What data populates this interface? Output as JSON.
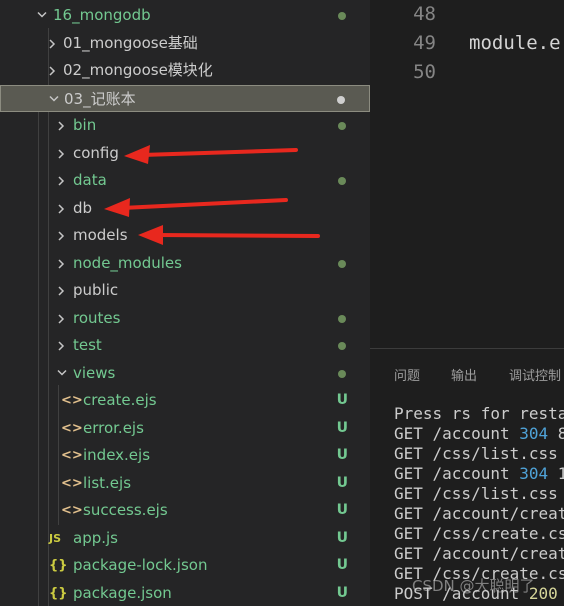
{
  "tree": [
    {
      "label": "16_mongodb",
      "kind": "folder-open",
      "indent": 0,
      "marker": "dot",
      "color": "#73c991"
    },
    {
      "label": "01_mongoose基础",
      "kind": "folder",
      "indent": 1,
      "color": "#cccccc"
    },
    {
      "label": "02_mongoose模块化",
      "kind": "folder",
      "indent": 1,
      "color": "#cccccc"
    },
    {
      "label": "03_记账本",
      "kind": "folder-open",
      "indent": 1,
      "selected": true,
      "marker": "dot-light",
      "color": "#cccccc"
    },
    {
      "label": "bin",
      "kind": "folder",
      "indent": 2,
      "marker": "dot",
      "color": "#73c991"
    },
    {
      "label": "config",
      "kind": "folder",
      "indent": 2,
      "color": "#cccccc"
    },
    {
      "label": "data",
      "kind": "folder",
      "indent": 2,
      "marker": "dot",
      "color": "#73c991"
    },
    {
      "label": "db",
      "kind": "folder",
      "indent": 2,
      "color": "#cccccc"
    },
    {
      "label": "models",
      "kind": "folder",
      "indent": 2,
      "color": "#cccccc"
    },
    {
      "label": "node_modules",
      "kind": "folder",
      "indent": 2,
      "marker": "dot",
      "color": "#73c991"
    },
    {
      "label": "public",
      "kind": "folder",
      "indent": 2,
      "color": "#cccccc"
    },
    {
      "label": "routes",
      "kind": "folder",
      "indent": 2,
      "marker": "dot",
      "color": "#73c991"
    },
    {
      "label": "test",
      "kind": "folder",
      "indent": 2,
      "marker": "dot",
      "color": "#73c991"
    },
    {
      "label": "views",
      "kind": "folder-open",
      "indent": 2,
      "marker": "dot",
      "color": "#73c991"
    },
    {
      "label": "create.ejs",
      "kind": "ejs",
      "indent": 3,
      "marker": "U",
      "color": "#73c991"
    },
    {
      "label": "error.ejs",
      "kind": "ejs",
      "indent": 3,
      "marker": "U",
      "color": "#73c991"
    },
    {
      "label": "index.ejs",
      "kind": "ejs",
      "indent": 3,
      "marker": "U",
      "color": "#73c991"
    },
    {
      "label": "list.ejs",
      "kind": "ejs",
      "indent": 3,
      "marker": "U",
      "color": "#73c991"
    },
    {
      "label": "success.ejs",
      "kind": "ejs",
      "indent": 3,
      "marker": "U",
      "color": "#73c991"
    },
    {
      "label": "app.js",
      "kind": "js",
      "indent": 2,
      "marker": "U",
      "color": "#73c991"
    },
    {
      "label": "package-lock.json",
      "kind": "json",
      "indent": 2,
      "marker": "U",
      "color": "#73c991"
    },
    {
      "label": "package.json",
      "kind": "json",
      "indent": 2,
      "marker": "U",
      "color": "#73c991"
    }
  ],
  "icons": {
    "ejs": "<>",
    "js": "JS",
    "json": "{}"
  },
  "editor": {
    "lines": [
      {
        "number": "48",
        "code": ""
      },
      {
        "number": "49",
        "code": "module.e"
      },
      {
        "number": "50",
        "code": ""
      }
    ]
  },
  "panel": {
    "tabs": [
      "问题",
      "输出",
      "调试控制"
    ],
    "terminal": [
      [
        {
          "t": "Press rs for restar"
        }
      ],
      [
        {
          "t": "GET /account "
        },
        {
          "t": "304",
          "c": "num"
        },
        {
          "t": " 8."
        }
      ],
      [
        {
          "t": "GET /css/list.css "
        },
        {
          "t": "3",
          "c": "num"
        }
      ],
      [
        {
          "t": "GET /account "
        },
        {
          "t": "304",
          "c": "num"
        },
        {
          "t": " 1."
        }
      ],
      [
        {
          "t": "GET /css/list.css "
        },
        {
          "t": "3",
          "c": "num"
        }
      ],
      [
        {
          "t": "GET /account/create"
        }
      ],
      [
        {
          "t": "GET /css/create.css"
        }
      ],
      [
        {
          "t": "GET /account/create"
        }
      ],
      [
        {
          "t": "GET /css/create.css"
        }
      ],
      [
        {
          "t": "POST /account "
        },
        {
          "t": "200",
          "c": "num2"
        },
        {
          "t": " 9"
        }
      ]
    ],
    "watermark": "CSDN @大聪明了"
  }
}
